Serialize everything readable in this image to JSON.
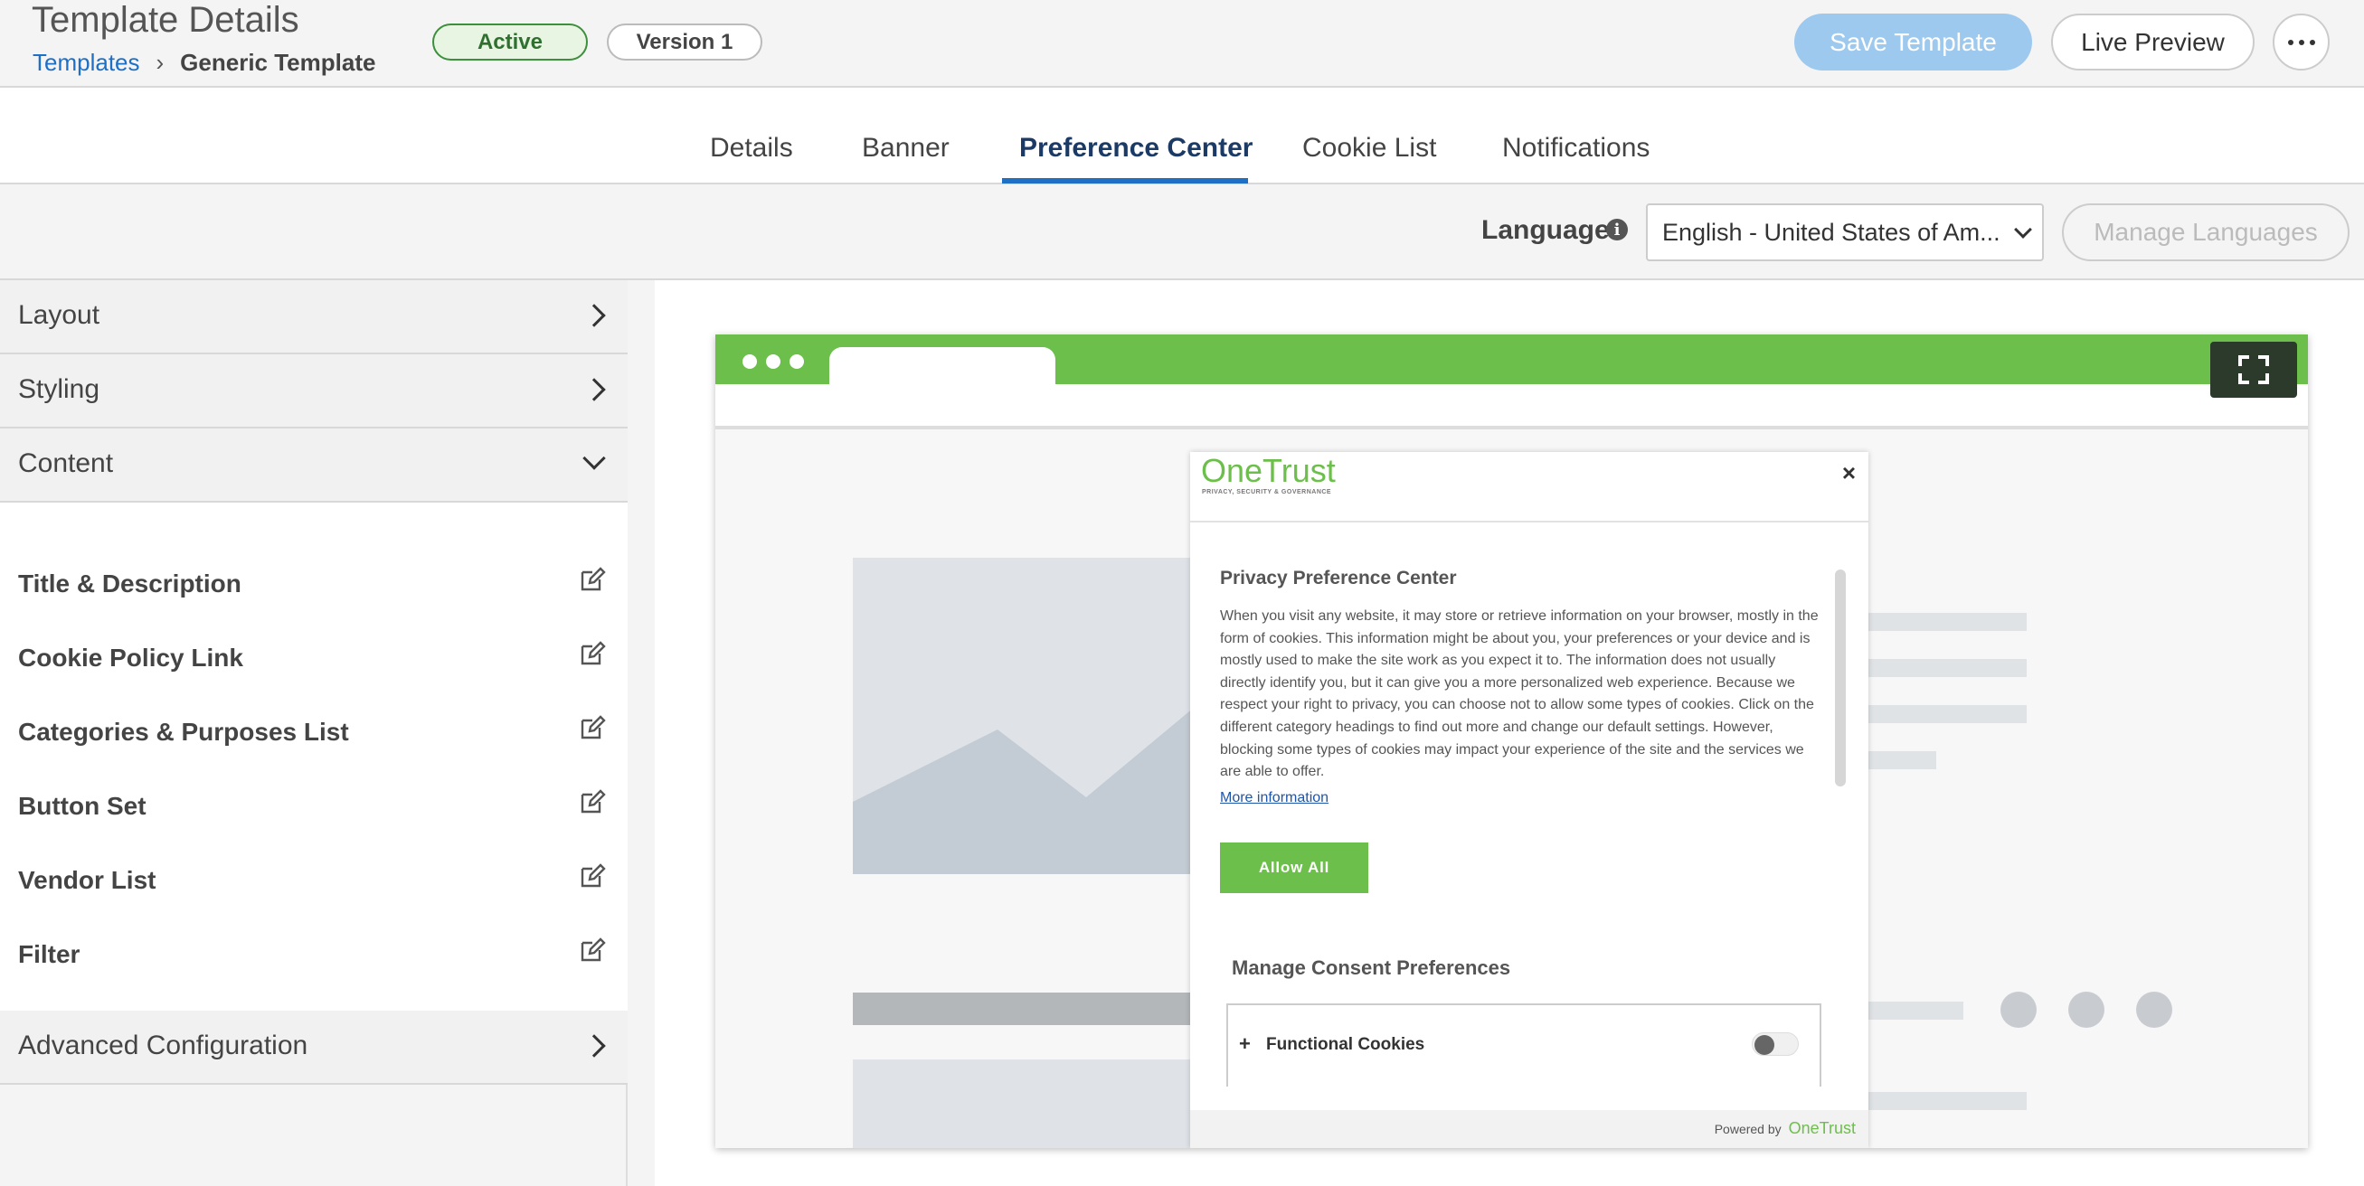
{
  "header": {
    "title": "Template Details",
    "breadcrumb": {
      "link": "Templates",
      "separator": "›",
      "current": "Generic Template"
    },
    "status_badge": "Active",
    "version_badge": "Version 1",
    "save_label": "Save Template",
    "preview_label": "Live Preview",
    "more_icon": "more-horizontal-icon"
  },
  "tabs": [
    {
      "label": "Details",
      "active": false
    },
    {
      "label": "Banner",
      "active": false
    },
    {
      "label": "Preference Center",
      "active": true
    },
    {
      "label": "Cookie List",
      "active": false
    },
    {
      "label": "Notifications",
      "active": false
    }
  ],
  "language_bar": {
    "label": "Language",
    "info_icon": "i",
    "selected_language": "English - United States of Am...",
    "manage_label": "Manage Languages"
  },
  "sidebar": {
    "sections": [
      {
        "label": "Layout",
        "expanded": false
      },
      {
        "label": "Styling",
        "expanded": false
      },
      {
        "label": "Content",
        "expanded": true
      },
      {
        "label": "Advanced Configuration",
        "expanded": false
      }
    ],
    "content_items": [
      {
        "label": "Title & Description"
      },
      {
        "label": "Cookie Policy Link"
      },
      {
        "label": "Categories & Purposes List"
      },
      {
        "label": "Button Set"
      },
      {
        "label": "Vendor List"
      },
      {
        "label": "Filter"
      }
    ]
  },
  "preview": {
    "modal": {
      "logo": "OneTrust",
      "logo_tagline": "PRIVACY, SECURITY & GOVERNANCE",
      "close": "×",
      "title": "Privacy Preference Center",
      "description": "When you visit any website, it may store or retrieve information on your browser, mostly in the form of cookies. This information might be about you, your preferences or your device and is mostly used to make the site work as you expect it to. The information does not usually directly identify you, but it can give you a more personalized web experience. Because we respect your right to privacy, you can choose not to allow some types of cookies. Click on the different category headings to find out more and change our default settings. However, blocking some types of cookies may impact your experience of the site and the services we are able to offer.",
      "more_info": "More information",
      "allow_all": "Allow All",
      "consent_title": "Manage Consent Preferences",
      "cookie_category": {
        "plus": "+",
        "label": "Functional Cookies",
        "enabled": false
      },
      "powered_by": "Powered by",
      "powered_brand": "OneTrust"
    }
  },
  "colors": {
    "accent_blue": "#1f6fc4",
    "onetrust_green": "#6cbf4a",
    "save_disabled": "#9ec9ef"
  }
}
